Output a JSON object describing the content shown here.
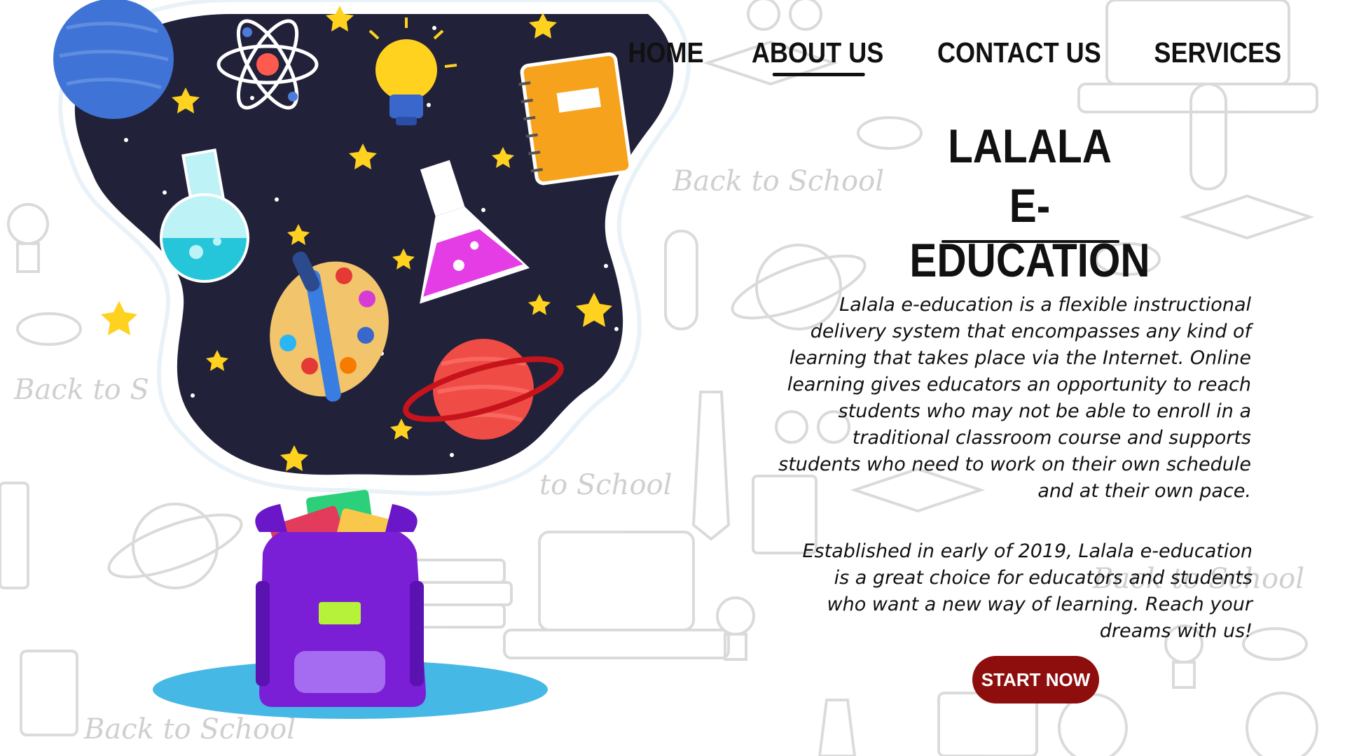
{
  "nav": {
    "items": [
      {
        "label": "HOME"
      },
      {
        "label": "ABOUT US"
      },
      {
        "label": "CONTACT US"
      },
      {
        "label": "SERVICES"
      }
    ]
  },
  "hero": {
    "title_line1": "LALALA",
    "title_line2": "E-EDUCATION",
    "paragraph1": "Lalala e-education is a flexible instructional delivery system that encompasses any kind of learning that takes place via the Internet. Online learning gives educators an opportunity to reach students who may not be able to enroll in a traditional classroom course and supports students who need to work on their own schedule and at their own pace.",
    "paragraph2": "Established in early of 2019, Lalala e-education is a great choice for educators and students who want a new way of learning. Reach your dreams with us!",
    "cta_label": "START NOW"
  },
  "background": {
    "doodle_text": "Back to School"
  },
  "colors": {
    "cta": "#8e0e0e",
    "space": "#22213a",
    "backpack": "#7a1fd6"
  }
}
